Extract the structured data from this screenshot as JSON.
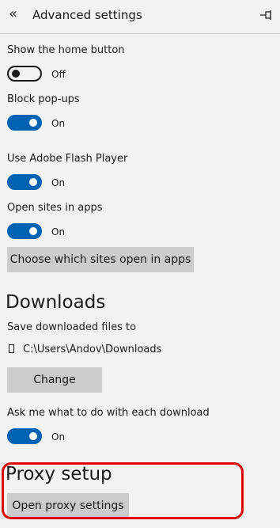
{
  "header": {
    "back_icon": "«",
    "title": "Advanced settings",
    "pin_icon": "pin-icon"
  },
  "settings": {
    "home_button": {
      "label": "Show the home button",
      "state": "Off",
      "on": false
    },
    "popups": {
      "label": "Block pop-ups",
      "state": "On",
      "on": true
    },
    "flash": {
      "label": "Use Adobe Flash Player",
      "state": "On",
      "on": true
    },
    "apps": {
      "label": "Open sites in apps",
      "state": "On",
      "on": true
    },
    "apps_button": "Choose which sites open in apps"
  },
  "downloads": {
    "title": "Downloads",
    "save_label": "Save downloaded files to",
    "path": "C:\\Users\\Andov\\Downloads",
    "change_button": "Change",
    "ask_label": "Ask me what to do with each download",
    "ask_state": "On",
    "ask_on": true
  },
  "proxy": {
    "title": "Proxy setup",
    "button": "Open proxy settings"
  },
  "colors": {
    "accent": "#0063b1",
    "highlight": "#e00000",
    "background": "#f2f2f2",
    "button": "#cccccc"
  }
}
